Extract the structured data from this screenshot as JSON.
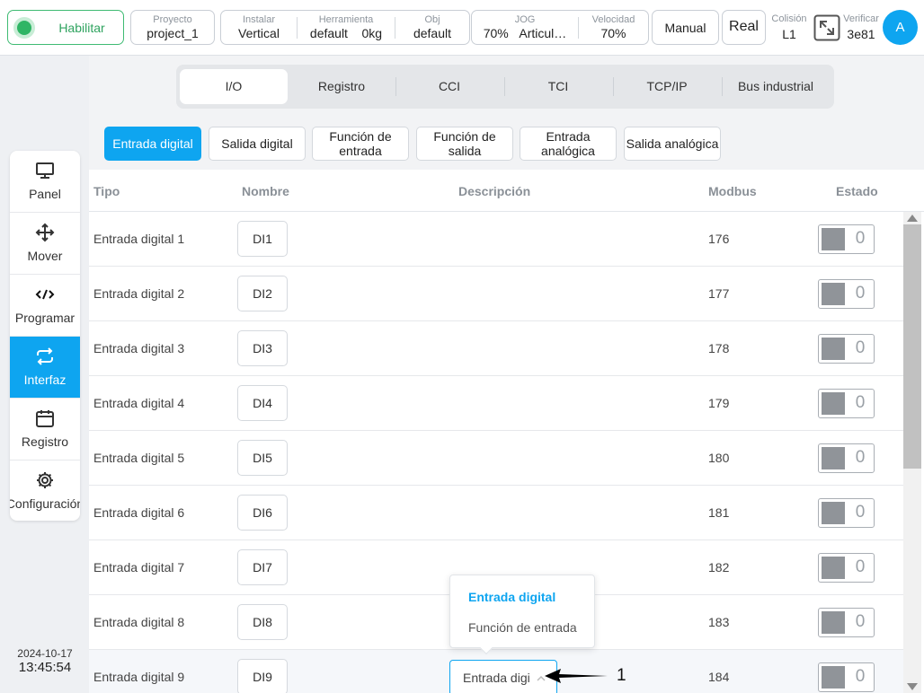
{
  "topbar": {
    "enable_label": "Habilitar",
    "project": {
      "key": "Proyecto",
      "value": "project_1"
    },
    "install": {
      "key": "Instalar",
      "value": "Vertical"
    },
    "tool": {
      "key": "Herramienta",
      "value": "default",
      "extra": "0kg"
    },
    "obj": {
      "key": "Obj",
      "value": "default"
    },
    "jog": {
      "key": "JOG",
      "value": "70%",
      "mode": "Articul…"
    },
    "speed": {
      "key": "Velocidad",
      "value": "70%"
    },
    "manual_label": "Manual",
    "real_label": "Real",
    "collision": {
      "key": "Colisión",
      "value": "L1"
    },
    "verify": {
      "key": "Verificar",
      "value": "3e81"
    },
    "avatar": "A",
    "colors": {
      "enable_green": "#2fb565",
      "accent": "#0ea5f0"
    }
  },
  "sidenav": {
    "items": [
      {
        "label": "Panel",
        "icon": "monitor-icon"
      },
      {
        "label": "Mover",
        "icon": "move-icon"
      },
      {
        "label": "Programar",
        "icon": "code-icon"
      },
      {
        "label": "Interfaz",
        "icon": "swap-icon",
        "active": true
      },
      {
        "label": "Registro",
        "icon": "calendar-icon"
      },
      {
        "label": "Configuración",
        "icon": "gear-icon"
      }
    ],
    "date": "2024-10-17",
    "time": "13:45:54"
  },
  "tabs": [
    "I/O",
    "Registro",
    "CCI",
    "TCI",
    "TCP/IP",
    "Bus industrial"
  ],
  "subtabs": [
    "Entrada digital",
    "Salida digital",
    "Función de entrada",
    "Función de salida",
    "Entrada analógica",
    "Salida analógica"
  ],
  "table": {
    "headers": {
      "type": "Tipo",
      "name": "Nombre",
      "description": "Descripción",
      "modbus": "Modbus",
      "state": "Estado"
    },
    "rows": [
      {
        "type": "Entrada digital 1",
        "name": "DI1",
        "modbus": "176",
        "state": "0"
      },
      {
        "type": "Entrada digital 2",
        "name": "DI2",
        "modbus": "177",
        "state": "0"
      },
      {
        "type": "Entrada digital 3",
        "name": "DI3",
        "modbus": "178",
        "state": "0"
      },
      {
        "type": "Entrada digital 4",
        "name": "DI4",
        "modbus": "179",
        "state": "0"
      },
      {
        "type": "Entrada digital 5",
        "name": "DI5",
        "modbus": "180",
        "state": "0"
      },
      {
        "type": "Entrada digital 6",
        "name": "DI6",
        "modbus": "181",
        "state": "0"
      },
      {
        "type": "Entrada digital 7",
        "name": "DI7",
        "modbus": "182",
        "state": "0"
      },
      {
        "type": "Entrada digital 8",
        "name": "DI8",
        "modbus": "183",
        "state": "0"
      },
      {
        "type": "Entrada digital 9",
        "name": "DI9",
        "modbus": "184",
        "state": "0",
        "description_select": "Entrada digi"
      }
    ]
  },
  "dropdown": {
    "options": [
      "Entrada digital",
      "Función de entrada"
    ],
    "selected": "Entrada digital"
  },
  "annotation": {
    "label": "1"
  }
}
